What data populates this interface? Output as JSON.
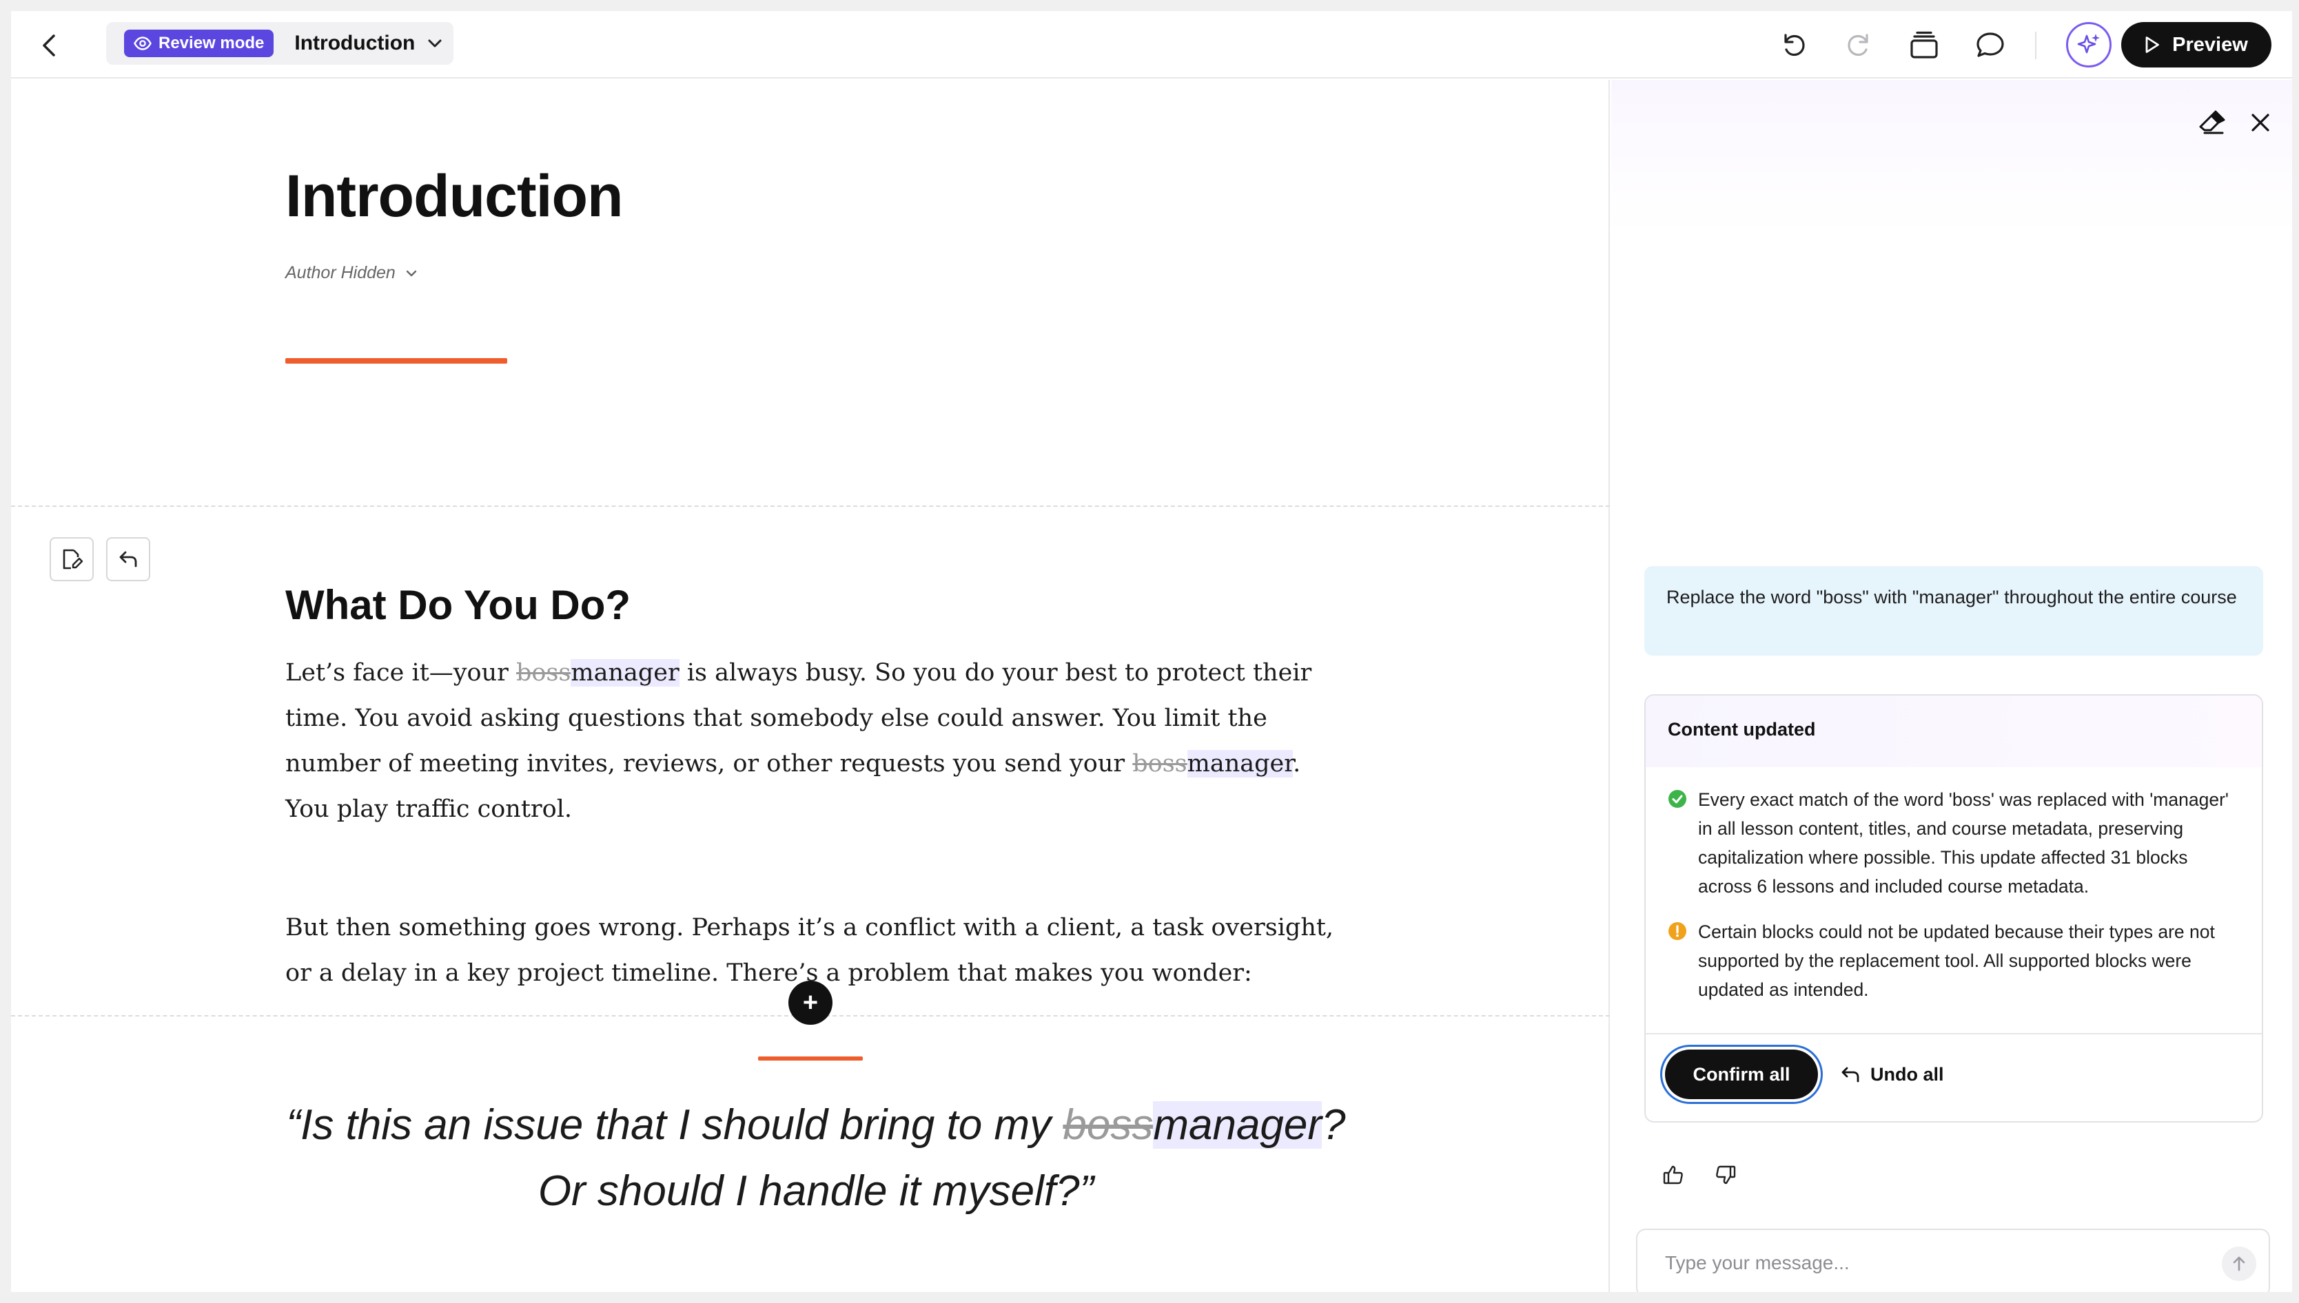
{
  "header": {
    "review_mode_label": "Review mode",
    "lesson_title": "Introduction",
    "preview_label": "Preview"
  },
  "lesson": {
    "title": "Introduction",
    "author": "Author Hidden",
    "section_heading": "What Do You Do?",
    "paragraph1": {
      "p1": "Let’s face it—your ",
      "del1": "boss",
      "ins1": "manager",
      "p2": " is always busy. So you do your best to protect their time. You avoid asking questions that somebody else could answer. You limit the number of meeting invites, reviews, or other requests you send your ",
      "del2": "boss",
      "ins2": "manager",
      "p3": ". You play traffic control."
    },
    "paragraph2": "But then something goes wrong. Perhaps it’s a conflict with a client, a task oversight, or a delay in a key project timeline. There’s a problem that makes you wonder:",
    "quote": {
      "p1": "“Is this an issue that I should bring to my ",
      "del": "boss",
      "ins": "manager",
      "p2": "? Or should I handle it myself?”"
    }
  },
  "assistant": {
    "user_message": "Replace the word \"boss\" with \"manager\" throughout the entire course",
    "result_title": "Content updated",
    "results": [
      {
        "status": "success",
        "text": "Every exact match of the word 'boss' was replaced with 'manager' in all lesson content, titles, and course metadata, preserving capitalization where possible. This update affected 31 blocks across 6 lessons and included course metadata."
      },
      {
        "status": "warning",
        "text": "Certain blocks could not be updated because their types are not supported by the replacement tool. All supported blocks were updated as intended."
      }
    ],
    "confirm_label": "Confirm all",
    "undo_label": "Undo all",
    "input_placeholder": "Type your message..."
  },
  "colors": {
    "accent_purple": "#5b47e0",
    "accent_orange": "#ee5d2b",
    "success": "#3db44a",
    "warning": "#f0a21b"
  }
}
